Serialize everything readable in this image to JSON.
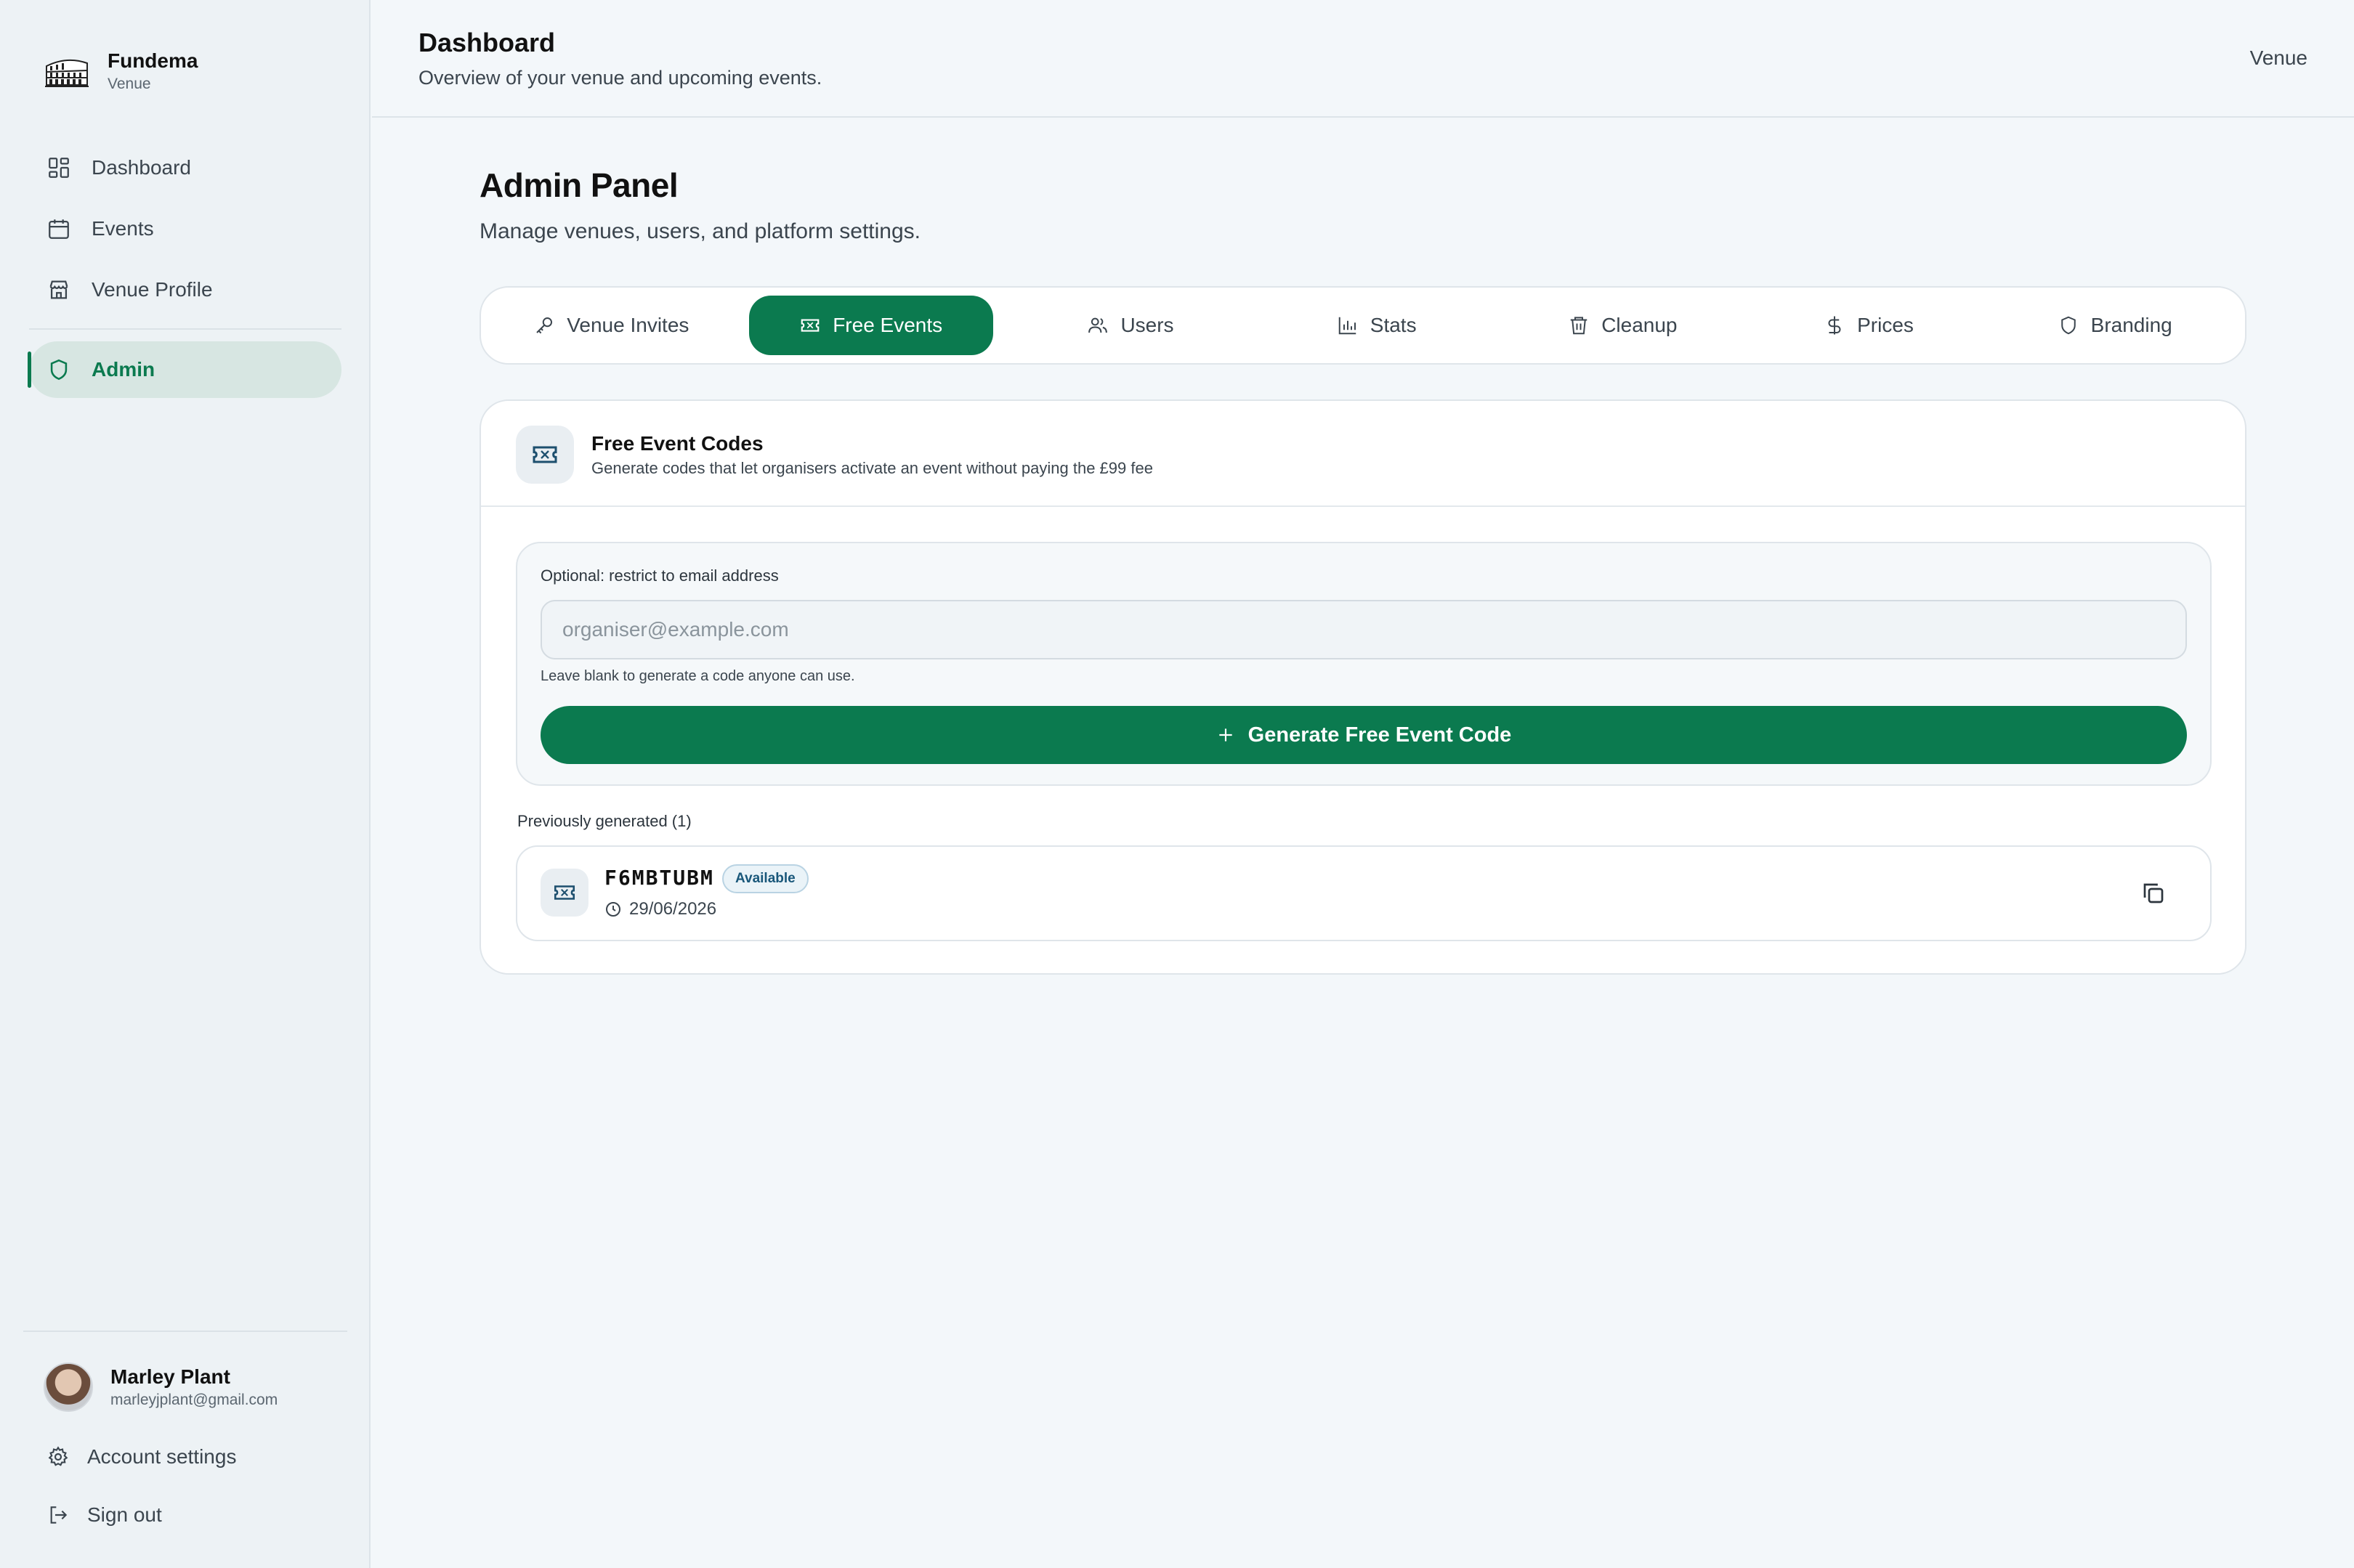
{
  "brand": {
    "name": "Fundema",
    "subtitle": "Venue"
  },
  "sidebar": {
    "items": [
      {
        "label": "Dashboard",
        "icon": "dashboard-grid-icon"
      },
      {
        "label": "Events",
        "icon": "calendar-icon"
      },
      {
        "label": "Venue Profile",
        "icon": "store-icon"
      }
    ],
    "admin": {
      "label": "Admin",
      "icon": "shield-icon",
      "active": true
    }
  },
  "user": {
    "name": "Marley Plant",
    "email": "marleyjplant@gmail.com"
  },
  "footer_links": {
    "account_settings": "Account settings",
    "sign_out": "Sign out"
  },
  "header": {
    "title": "Dashboard",
    "subtitle": "Overview of your venue and upcoming events.",
    "role": "Venue"
  },
  "admin_panel": {
    "title": "Admin Panel",
    "subtitle": "Manage venues, users, and platform settings."
  },
  "tabs": [
    {
      "label": "Venue Invites",
      "icon": "key-icon"
    },
    {
      "label": "Free Events",
      "icon": "ticket-icon",
      "active": true
    },
    {
      "label": "Users",
      "icon": "users-icon"
    },
    {
      "label": "Stats",
      "icon": "bar-chart-icon"
    },
    {
      "label": "Cleanup",
      "icon": "trash-icon"
    },
    {
      "label": "Prices",
      "icon": "dollar-icon"
    },
    {
      "label": "Branding",
      "icon": "shield-icon"
    }
  ],
  "free_events": {
    "title": "Free Event Codes",
    "description": "Generate codes that let organisers activate an event without paying the £99 fee",
    "email_label": "Optional: restrict to email address",
    "email_placeholder": "organiser@example.com",
    "email_value": "",
    "help_text": "Leave blank to generate a code anyone can use.",
    "generate_label": "Generate Free Event Code",
    "previous_label": "Previously generated (1)",
    "codes": [
      {
        "code": "F6MBTUBM",
        "status": "Available",
        "date": "29/06/2026"
      }
    ]
  },
  "colors": {
    "accent": "#0b7a4f",
    "accent_soft": "#d7e6e2",
    "background": "#f3f7fa",
    "badge": "#19577a"
  }
}
